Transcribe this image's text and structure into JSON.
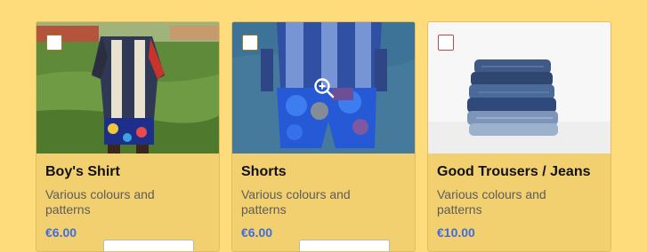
{
  "products": [
    {
      "title": "Boy's Shirt",
      "description": "Various colours and patterns",
      "price": "€6.00",
      "image_icon": "boys-shirt-photo"
    },
    {
      "title": "Shorts",
      "description": "Various colours and patterns",
      "price": "€6.00",
      "image_icon": "shorts-photo",
      "hovered": true
    },
    {
      "title": "Good Trousers / Jeans",
      "description": "Various colours and patterns",
      "price": "€10.00",
      "image_icon": "jeans-photo"
    }
  ],
  "colors": {
    "background": "#fedb7b",
    "card": "#f2d06f",
    "price": "#3d6de0",
    "hover_overlay": "#2660e1"
  }
}
